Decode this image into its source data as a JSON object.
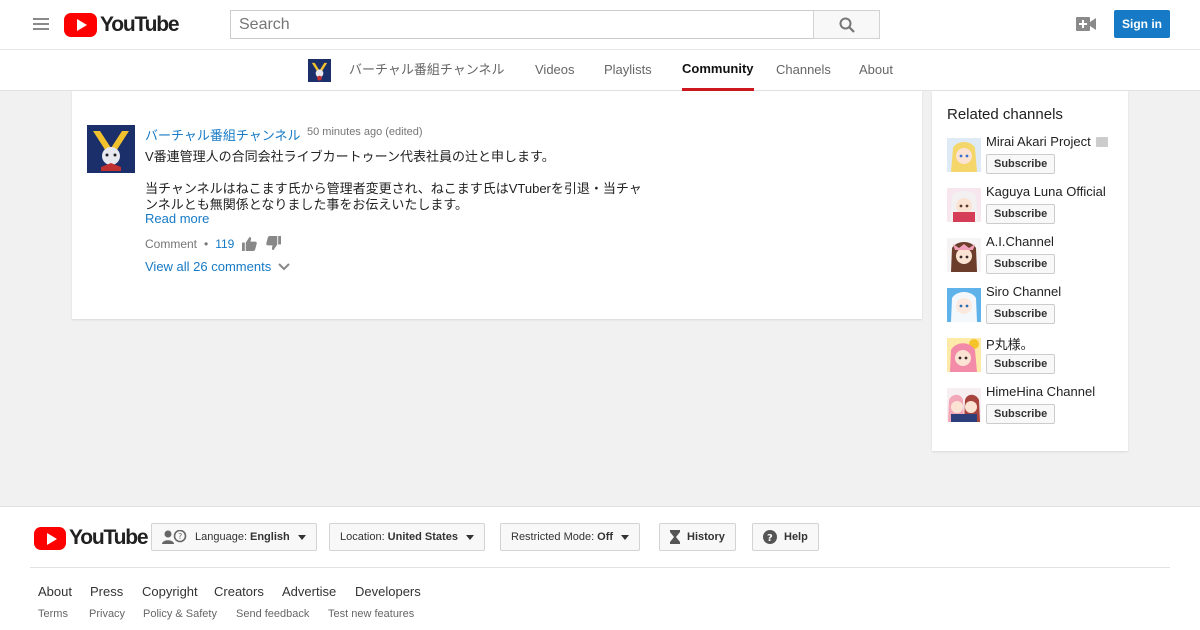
{
  "masthead": {
    "logo_text": "YouTube",
    "search_placeholder": "Search",
    "sign_in_label": "Sign in"
  },
  "channel_nav": {
    "channel_name": "バーチャル番組チャンネル",
    "tabs": [
      "Videos",
      "Playlists",
      "Community",
      "Channels",
      "About"
    ],
    "active_tab": "Community"
  },
  "post": {
    "author": "バーチャル番組チャンネル",
    "time": "50 minutes ago (edited)",
    "lines": [
      "V番連管理人の合同会社ライブカートゥーン代表社員の辻と申します。",
      "当チャンネルはねこます氏から管理者変更され、ねこます氏はVTuberを引退・当チャ",
      "ンネルとも無関係となりました事をお伝えいたします。"
    ],
    "read_more": "Read more",
    "comment_label": "Comment",
    "dot": "•",
    "like_count": "119",
    "view_all": "View all 26 comments"
  },
  "related": {
    "title": "Related channels",
    "subscribe_label": "Subscribe",
    "channels": [
      {
        "name": "Mirai Akari Project",
        "verified": true
      },
      {
        "name": "Kaguya Luna Official",
        "verified": false
      },
      {
        "name": "A.I.Channel",
        "verified": false
      },
      {
        "name": "Siro Channel",
        "verified": false
      },
      {
        "name": "P丸様。",
        "verified": false
      },
      {
        "name": "HimeHina Channel",
        "verified": false
      }
    ]
  },
  "footer": {
    "logo_text": "YouTube",
    "language_label": "Language:",
    "language_value": "English",
    "location_label": "Location:",
    "location_value": "United States",
    "restricted_label": "Restricted Mode:",
    "restricted_value": "Off",
    "history_label": "History",
    "help_label": "Help",
    "links_primary": [
      "About",
      "Press",
      "Copyright",
      "Creators",
      "Advertise",
      "Developers"
    ],
    "links_secondary": [
      "Terms",
      "Privacy",
      "Policy & Safety",
      "Send feedback",
      "Test new features"
    ]
  },
  "colors": {
    "brand_red": "#ff0000",
    "link_blue": "#167ac6",
    "active_tab_underline": "#cc181e",
    "page_background": "#f1f1f1"
  }
}
